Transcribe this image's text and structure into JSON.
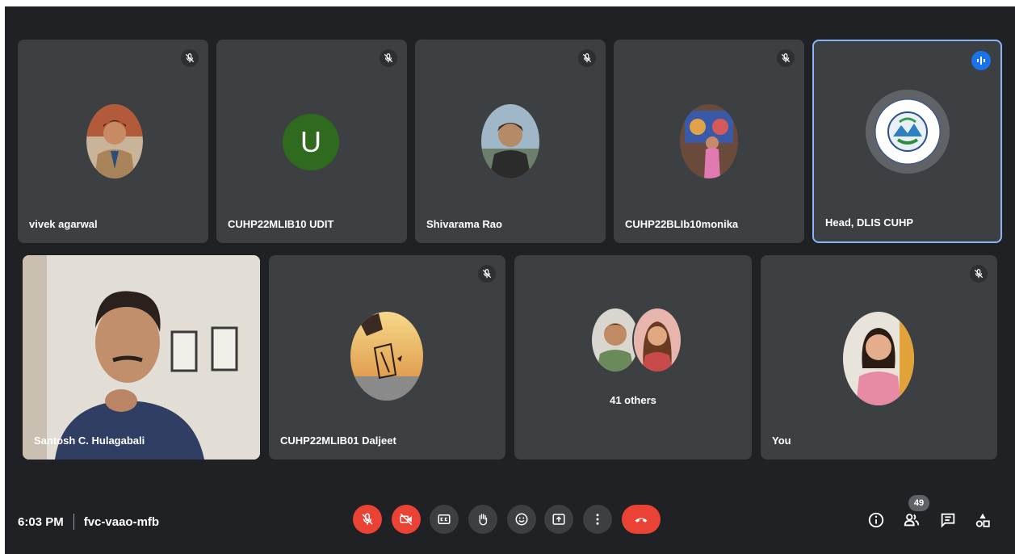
{
  "participants": {
    "vivek": "vivek agarwal",
    "udit": "CUHP22MLIB10 UDIT",
    "udit_initial": "U",
    "shivarama": "Shivarama Rao",
    "monika": "CUHP22BLIb10monika",
    "head": "Head, DLIS CUHP",
    "santosh": "Santosh C. Hulagabali",
    "daljeet": "CUHP22MLIB01 Daljeet",
    "others": "41 others",
    "you": "You"
  },
  "meeting": {
    "time": "6:03 PM",
    "code": "fvc-vaao-mfb",
    "participant_count": "49"
  },
  "colors": {
    "stage": "#202124",
    "tile": "#3c4043",
    "active_border": "#8ab4f8",
    "danger": "#ea4335",
    "speaking": "#1a73e8",
    "initial_avatar": "#2e6b1e"
  },
  "icons": {
    "tile_status": "mic-off-icon",
    "speaking": "audio-level-icon",
    "controls": [
      "mic-off-icon",
      "camera-off-icon",
      "captions-icon",
      "raise-hand-icon",
      "emoji-icon",
      "present-icon",
      "more-options-icon",
      "end-call-icon"
    ],
    "side": [
      "info-icon",
      "people-icon",
      "chat-icon",
      "activities-icon"
    ]
  }
}
